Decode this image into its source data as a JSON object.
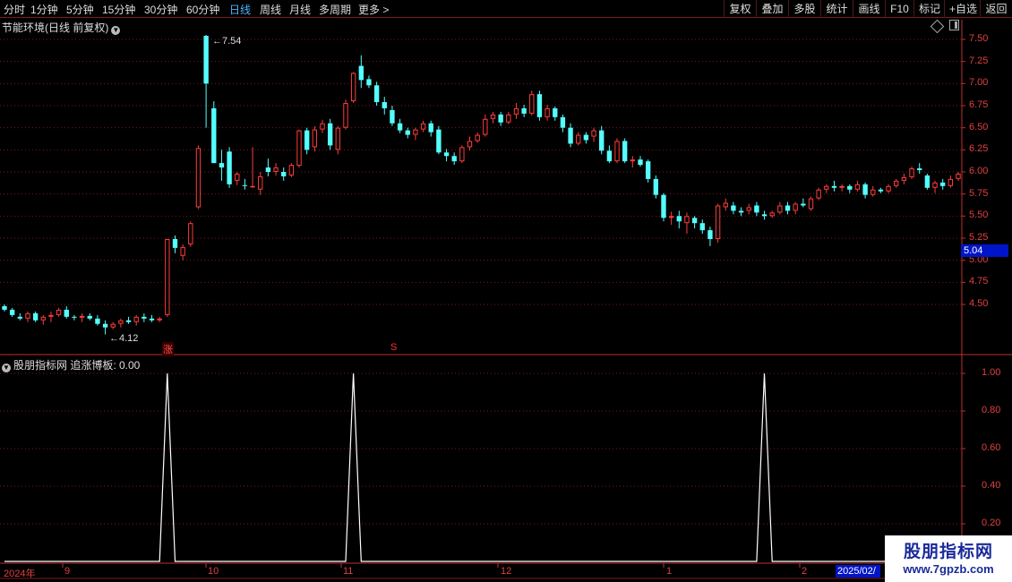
{
  "toolbar": {
    "periods": [
      "分时",
      "1分钟",
      "5分钟",
      "15分钟",
      "30分钟",
      "60分钟",
      "日线",
      "周线",
      "月线",
      "多周期",
      "更多"
    ],
    "active_period": "日线",
    "right_buttons": [
      "复权",
      "叠加",
      "多股",
      "统计",
      "画线",
      "F10",
      "标记",
      "+自选",
      "返回"
    ]
  },
  "main_chart": {
    "title": "节能环境(日线 前复权)",
    "y_labels": [
      "7.50",
      "7.25",
      "7.00",
      "6.75",
      "6.50",
      "6.25",
      "6.00",
      "5.75",
      "5.50",
      "5.25",
      "5.00",
      "4.75",
      "4.50"
    ],
    "current_price": "5.04",
    "high_label": "7.54",
    "low_label": "4.12",
    "marker_zhang": "涨",
    "marker_s": "S",
    "colors": {
      "up": "#ff3c3c",
      "down": "#54ffff",
      "grid": "#7a1a1a"
    }
  },
  "indicator": {
    "title": "股朋指标网 追涨博板: 0.00",
    "y_labels": [
      "1.00",
      "0.80",
      "0.60",
      "0.40",
      "0.20"
    ]
  },
  "x_axis": {
    "labels": [
      "2024年",
      "9",
      "10",
      "11",
      "12",
      "1",
      "2"
    ],
    "current_date": "2025/02/"
  },
  "watermark": {
    "line1": "股朋指标网",
    "line2": "www.7gpzb.com"
  },
  "chart_data": {
    "type": "candlestick",
    "ylim": [
      4.0,
      7.6
    ],
    "candles": [
      [
        4.48,
        4.5,
        4.42,
        4.44
      ],
      [
        4.44,
        4.46,
        4.36,
        4.38
      ],
      [
        4.36,
        4.4,
        4.32,
        4.34
      ],
      [
        4.34,
        4.42,
        4.3,
        4.4
      ],
      [
        4.4,
        4.42,
        4.3,
        4.32
      ],
      [
        4.32,
        4.38,
        4.27,
        4.36
      ],
      [
        4.36,
        4.42,
        4.3,
        4.38
      ],
      [
        4.38,
        4.46,
        4.36,
        4.44
      ],
      [
        4.44,
        4.48,
        4.34,
        4.36
      ],
      [
        4.36,
        4.38,
        4.32,
        4.35
      ],
      [
        4.35,
        4.4,
        4.3,
        4.37
      ],
      [
        4.37,
        4.4,
        4.32,
        4.34
      ],
      [
        4.34,
        4.38,
        4.26,
        4.28
      ],
      [
        4.28,
        4.32,
        4.16,
        4.24
      ],
      [
        4.24,
        4.3,
        4.22,
        4.28
      ],
      [
        4.28,
        4.34,
        4.24,
        4.32
      ],
      [
        4.32,
        4.36,
        4.28,
        4.3
      ],
      [
        4.3,
        4.38,
        4.26,
        4.36
      ],
      [
        4.36,
        4.4,
        4.3,
        4.34
      ],
      [
        4.34,
        4.38,
        4.3,
        4.32
      ],
      [
        4.32,
        4.36,
        4.3,
        4.34
      ],
      [
        4.38,
        5.24,
        4.36,
        5.24
      ],
      [
        5.24,
        5.28,
        5.08,
        5.14
      ],
      [
        5.05,
        5.18,
        5.0,
        5.15
      ],
      [
        5.18,
        5.44,
        5.15,
        5.42
      ],
      [
        5.6,
        6.3,
        5.58,
        6.27
      ],
      [
        7.54,
        7.55,
        6.5,
        7.0
      ],
      [
        6.72,
        6.8,
        6.1,
        6.1
      ],
      [
        6.1,
        6.25,
        5.9,
        6.05
      ],
      [
        6.23,
        6.28,
        5.82,
        5.86
      ],
      [
        5.9,
        6.0,
        5.85,
        5.98
      ],
      [
        5.85,
        5.92,
        5.8,
        5.84
      ],
      [
        5.84,
        6.28,
        5.82,
        5.84
      ],
      [
        5.8,
        6.0,
        5.74,
        5.95
      ],
      [
        6.05,
        6.15,
        5.95,
        6.0
      ],
      [
        6.0,
        6.1,
        5.96,
        6.05
      ],
      [
        6.0,
        6.05,
        5.9,
        5.95
      ],
      [
        5.96,
        6.1,
        5.94,
        6.08
      ],
      [
        6.07,
        6.48,
        6.05,
        6.47
      ],
      [
        6.47,
        6.5,
        6.2,
        6.25
      ],
      [
        6.28,
        6.52,
        6.23,
        6.48
      ],
      [
        6.48,
        6.59,
        6.44,
        6.55
      ],
      [
        6.55,
        6.6,
        6.25,
        6.3
      ],
      [
        6.25,
        6.52,
        6.2,
        6.5
      ],
      [
        6.5,
        6.82,
        6.48,
        6.78
      ],
      [
        6.8,
        7.13,
        6.78,
        7.12
      ],
      [
        7.2,
        7.32,
        6.95,
        7.04
      ],
      [
        7.05,
        7.09,
        6.95,
        6.98
      ],
      [
        6.98,
        7.02,
        6.75,
        6.79
      ],
      [
        6.79,
        6.85,
        6.65,
        6.72
      ],
      [
        6.7,
        6.75,
        6.52,
        6.55
      ],
      [
        6.55,
        6.6,
        6.44,
        6.47
      ],
      [
        6.47,
        6.5,
        6.38,
        6.42
      ],
      [
        6.42,
        6.5,
        6.36,
        6.48
      ],
      [
        6.48,
        6.58,
        6.45,
        6.55
      ],
      [
        6.55,
        6.58,
        6.4,
        6.45
      ],
      [
        6.48,
        6.52,
        6.2,
        6.22
      ],
      [
        6.22,
        6.26,
        6.12,
        6.18
      ],
      [
        6.18,
        6.22,
        6.08,
        6.12
      ],
      [
        6.12,
        6.3,
        6.1,
        6.28
      ],
      [
        6.28,
        6.4,
        6.24,
        6.35
      ],
      [
        6.35,
        6.45,
        6.33,
        6.42
      ],
      [
        6.42,
        6.65,
        6.4,
        6.6
      ],
      [
        6.6,
        6.68,
        6.55,
        6.65
      ],
      [
        6.65,
        6.68,
        6.52,
        6.56
      ],
      [
        6.56,
        6.68,
        6.54,
        6.65
      ],
      [
        6.65,
        6.78,
        6.6,
        6.72
      ],
      [
        6.72,
        6.76,
        6.62,
        6.66
      ],
      [
        6.66,
        6.92,
        6.64,
        6.88
      ],
      [
        6.88,
        6.92,
        6.58,
        6.62
      ],
      [
        6.62,
        6.76,
        6.58,
        6.72
      ],
      [
        6.72,
        6.74,
        6.58,
        6.62
      ],
      [
        6.62,
        6.65,
        6.45,
        6.5
      ],
      [
        6.5,
        6.55,
        6.28,
        6.32
      ],
      [
        6.32,
        6.45,
        6.3,
        6.42
      ],
      [
        6.42,
        6.45,
        6.32,
        6.36
      ],
      [
        6.4,
        6.5,
        6.34,
        6.47
      ],
      [
        6.47,
        6.52,
        6.2,
        6.24
      ],
      [
        6.24,
        6.3,
        6.1,
        6.12
      ],
      [
        6.12,
        6.38,
        6.1,
        6.35
      ],
      [
        6.35,
        6.38,
        6.1,
        6.12
      ],
      [
        6.12,
        6.18,
        6.05,
        6.14
      ],
      [
        6.14,
        6.18,
        6.06,
        6.08
      ],
      [
        6.12,
        6.14,
        5.88,
        5.92
      ],
      [
        5.92,
        5.96,
        5.7,
        5.74
      ],
      [
        5.74,
        5.76,
        5.44,
        5.48
      ],
      [
        5.48,
        5.55,
        5.4,
        5.5
      ],
      [
        5.5,
        5.56,
        5.36,
        5.44
      ],
      [
        5.42,
        5.54,
        5.3,
        5.5
      ],
      [
        5.48,
        5.5,
        5.36,
        5.42
      ],
      [
        5.42,
        5.46,
        5.3,
        5.34
      ],
      [
        5.34,
        5.38,
        5.16,
        5.24
      ],
      [
        5.24,
        5.64,
        5.2,
        5.62
      ],
      [
        5.6,
        5.7,
        5.56,
        5.65
      ],
      [
        5.62,
        5.66,
        5.52,
        5.56
      ],
      [
        5.56,
        5.6,
        5.5,
        5.54
      ],
      [
        5.56,
        5.64,
        5.52,
        5.6
      ],
      [
        5.62,
        5.66,
        5.5,
        5.54
      ],
      [
        5.52,
        5.56,
        5.46,
        5.5
      ],
      [
        5.5,
        5.56,
        5.48,
        5.54
      ],
      [
        5.54,
        5.66,
        5.52,
        5.62
      ],
      [
        5.62,
        5.66,
        5.52,
        5.56
      ],
      [
        5.56,
        5.66,
        5.52,
        5.64
      ],
      [
        5.64,
        5.7,
        5.6,
        5.62
      ],
      [
        5.58,
        5.72,
        5.56,
        5.7
      ],
      [
        5.7,
        5.82,
        5.68,
        5.8
      ],
      [
        5.8,
        5.86,
        5.76,
        5.84
      ],
      [
        5.84,
        5.9,
        5.78,
        5.82
      ],
      [
        5.82,
        5.86,
        5.78,
        5.84
      ],
      [
        5.84,
        5.86,
        5.76,
        5.8
      ],
      [
        5.8,
        5.9,
        5.78,
        5.86
      ],
      [
        5.86,
        5.88,
        5.7,
        5.74
      ],
      [
        5.74,
        5.84,
        5.72,
        5.8
      ],
      [
        5.8,
        5.82,
        5.76,
        5.78
      ],
      [
        5.78,
        5.86,
        5.76,
        5.84
      ],
      [
        5.84,
        5.92,
        5.82,
        5.9
      ],
      [
        5.9,
        5.98,
        5.86,
        5.94
      ],
      [
        5.94,
        6.06,
        5.92,
        6.04
      ],
      [
        6.04,
        6.1,
        5.98,
        6.02
      ],
      [
        5.96,
        5.98,
        5.8,
        5.82
      ],
      [
        5.82,
        5.9,
        5.76,
        5.88
      ],
      [
        5.88,
        5.92,
        5.8,
        5.84
      ],
      [
        5.84,
        5.96,
        5.82,
        5.92
      ],
      [
        5.92,
        6.0,
        5.9,
        5.98
      ]
    ],
    "indicator_values": [
      0,
      0,
      0,
      0,
      0,
      0,
      0,
      0,
      0,
      0,
      0,
      0,
      0,
      0,
      0,
      0,
      0,
      0,
      0,
      0,
      0,
      1,
      0,
      0,
      0,
      0,
      0,
      0,
      0,
      0,
      0,
      0,
      0,
      0,
      0,
      0,
      0,
      0,
      0,
      0,
      0,
      0,
      0,
      0,
      0,
      1,
      0,
      0,
      0,
      0,
      0,
      0,
      0,
      0,
      0,
      0,
      0,
      0,
      0,
      0,
      0,
      0,
      0,
      0,
      0,
      0,
      0,
      0,
      0,
      0,
      0,
      0,
      0,
      0,
      0,
      0,
      0,
      0,
      0,
      0,
      0,
      0,
      0,
      0,
      0,
      0,
      0,
      0,
      0,
      0,
      0,
      0,
      0,
      0,
      0,
      0,
      0,
      0,
      1,
      0,
      0,
      0,
      0,
      0,
      0,
      0,
      0,
      0,
      0,
      0,
      0,
      0,
      0,
      0,
      0,
      0,
      0,
      0,
      0,
      0,
      0,
      0,
      0,
      0,
      0,
      0,
      0,
      0,
      0,
      0,
      0,
      0,
      0
    ]
  }
}
